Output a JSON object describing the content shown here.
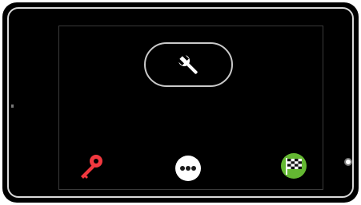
{
  "screen": {
    "tool_button": {
      "icon": "wrench-icon",
      "color": "#ffffff",
      "border_color": "#c9c9c9"
    },
    "bottom_bar": {
      "key_button": {
        "icon": "key-icon",
        "color": "#f2383f"
      },
      "more_button": {
        "icon": "more-dots-icon",
        "color": "#ffffff"
      },
      "finish_button": {
        "icon": "checkered-flag-icon",
        "color": "#64b832"
      }
    }
  },
  "device": {
    "body_color": "#000000",
    "hardware_button": {
      "icon": "home-button-icon"
    }
  }
}
